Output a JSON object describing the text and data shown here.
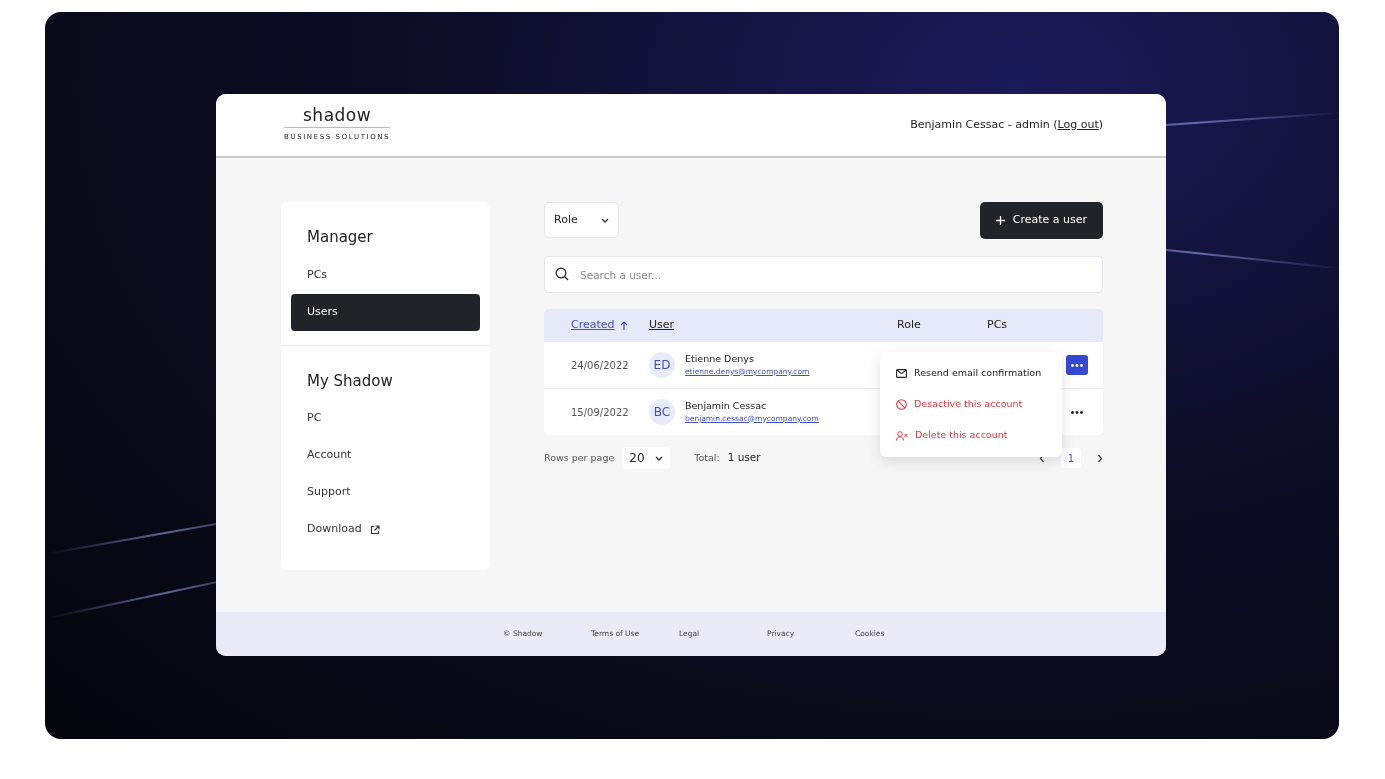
{
  "header": {
    "logo": {
      "wordmark": "shadow",
      "tagline": "BUSINESS SOLUTIONS"
    },
    "user_label": "Benjamin Cessac - admin (",
    "logout": "Log out",
    "user_label_end": ")"
  },
  "sidebar": {
    "sections": [
      {
        "title": "Manager",
        "items": [
          {
            "label": "PCs",
            "selected": false,
            "external": false
          },
          {
            "label": "Users",
            "selected": true,
            "external": false
          }
        ]
      },
      {
        "title": "My Shadow",
        "items": [
          {
            "label": "PC",
            "selected": false,
            "external": false
          },
          {
            "label": "Account",
            "selected": false,
            "external": false
          },
          {
            "label": "Support",
            "selected": false,
            "external": false
          },
          {
            "label": "Download",
            "selected": false,
            "external": true
          }
        ]
      }
    ]
  },
  "toolbar": {
    "role_filter": "Role",
    "create_button": "Create a user"
  },
  "search": {
    "placeholder": "Search a user..."
  },
  "table": {
    "columns": [
      {
        "label": "Created",
        "sortable": true,
        "sorted": true
      },
      {
        "label": "User",
        "sortable": true,
        "sorted": false
      },
      {
        "label": "Role",
        "sortable": false,
        "sorted": false
      },
      {
        "label": "PCs",
        "sortable": false,
        "sorted": false
      }
    ],
    "rows": [
      {
        "created": "24/06/2022",
        "initials": "ED",
        "name": "Etienne Denys",
        "email": "etienne.denys@mycompany.com",
        "menu_open": true
      },
      {
        "created": "15/09/2022",
        "initials": "BC",
        "name": "Benjamin Cessac",
        "email": "benjamin.cessac@mycompany.com",
        "menu_open": false
      }
    ]
  },
  "row_menu": {
    "items": [
      {
        "label": "Resend email confirmation",
        "kind": "mail",
        "danger": false
      },
      {
        "label": "Desactive this account",
        "kind": "block",
        "danger": true
      },
      {
        "label": "Delete this account",
        "kind": "remove-user",
        "danger": true
      }
    ]
  },
  "pagination": {
    "rows_per_page_label": "Rows per page",
    "rows_per_page": "20",
    "total_label": "Total:",
    "total": "1 user",
    "pages": [
      {
        "label": "1",
        "selected": true
      }
    ]
  },
  "footer": {
    "links": [
      "© Shadow",
      "Terms of Use",
      "Legal",
      "Privacy",
      "Cookies"
    ]
  }
}
